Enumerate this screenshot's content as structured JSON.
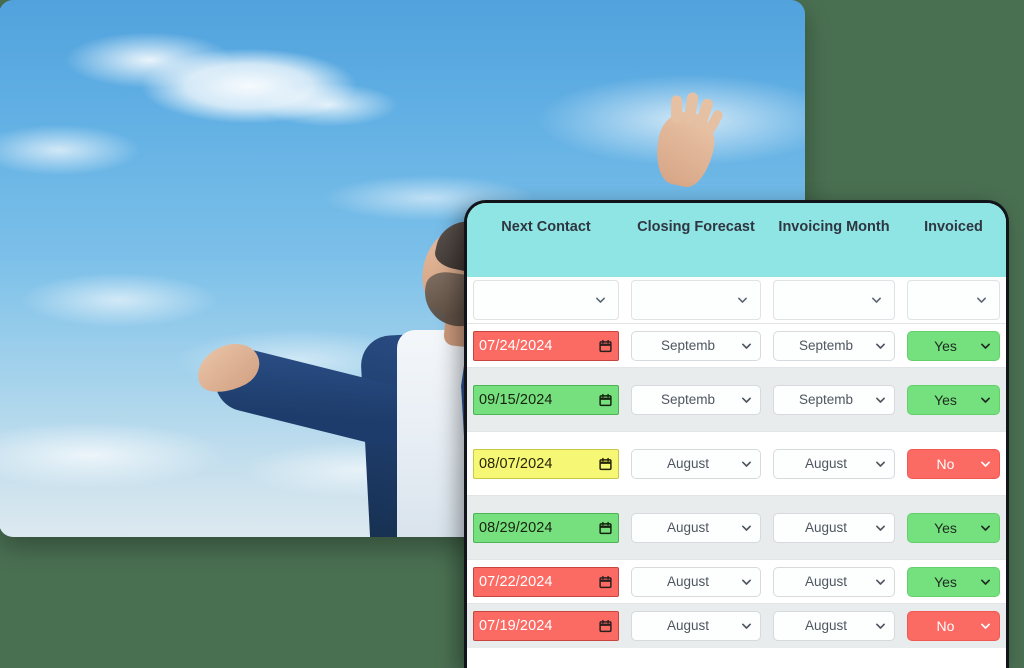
{
  "photo": {
    "alt": "Smiling bearded businessman in navy blue suit with arms outstretched against blue cloudy sky"
  },
  "table": {
    "columns": [
      {
        "key": "next_contact",
        "label": "Next Contact"
      },
      {
        "key": "closing_forecast",
        "label": "Closing Forecast"
      },
      {
        "key": "invoicing_month",
        "label": "Invoicing Month"
      },
      {
        "key": "invoiced",
        "label": "Invoiced"
      }
    ],
    "filters": [
      {
        "name": "next-contact-filter",
        "value": ""
      },
      {
        "name": "closing-forecast-filter",
        "value": ""
      },
      {
        "name": "invoicing-month-filter",
        "value": ""
      },
      {
        "name": "invoiced-filter",
        "value": ""
      }
    ],
    "rows": [
      {
        "next_contact": "07/24/2024",
        "next_contact_state": "red",
        "closing_forecast": "Septemb",
        "invoicing_month": "Septemb",
        "invoiced": "Yes",
        "invoiced_state": "yes",
        "height": "short"
      },
      {
        "next_contact": "09/15/2024",
        "next_contact_state": "green",
        "closing_forecast": "Septemb",
        "invoicing_month": "Septemb",
        "invoiced": "Yes",
        "invoiced_state": "yes",
        "height": "tall"
      },
      {
        "next_contact": "08/07/2024",
        "next_contact_state": "yellow",
        "closing_forecast": "August",
        "invoicing_month": "August",
        "invoiced": "No",
        "invoiced_state": "no",
        "height": "tall"
      },
      {
        "next_contact": "08/29/2024",
        "next_contact_state": "green",
        "closing_forecast": "August",
        "invoicing_month": "August",
        "invoiced": "Yes",
        "invoiced_state": "yes",
        "height": "tall"
      },
      {
        "next_contact": "07/22/2024",
        "next_contact_state": "red",
        "closing_forecast": "August",
        "invoicing_month": "August",
        "invoiced": "Yes",
        "invoiced_state": "yes",
        "height": "short"
      },
      {
        "next_contact": "07/19/2024",
        "next_contact_state": "red",
        "closing_forecast": "August",
        "invoicing_month": "August",
        "invoiced": "No",
        "invoiced_state": "no",
        "height": "short"
      }
    ]
  },
  "colors": {
    "background": "#4a7052",
    "header_teal": "#8fe4e4",
    "status_green": "#75e07e",
    "status_red": "#fb6a63",
    "status_yellow": "#f7f776",
    "panel_border": "#111418",
    "row_stripe": "#e9ecec"
  }
}
